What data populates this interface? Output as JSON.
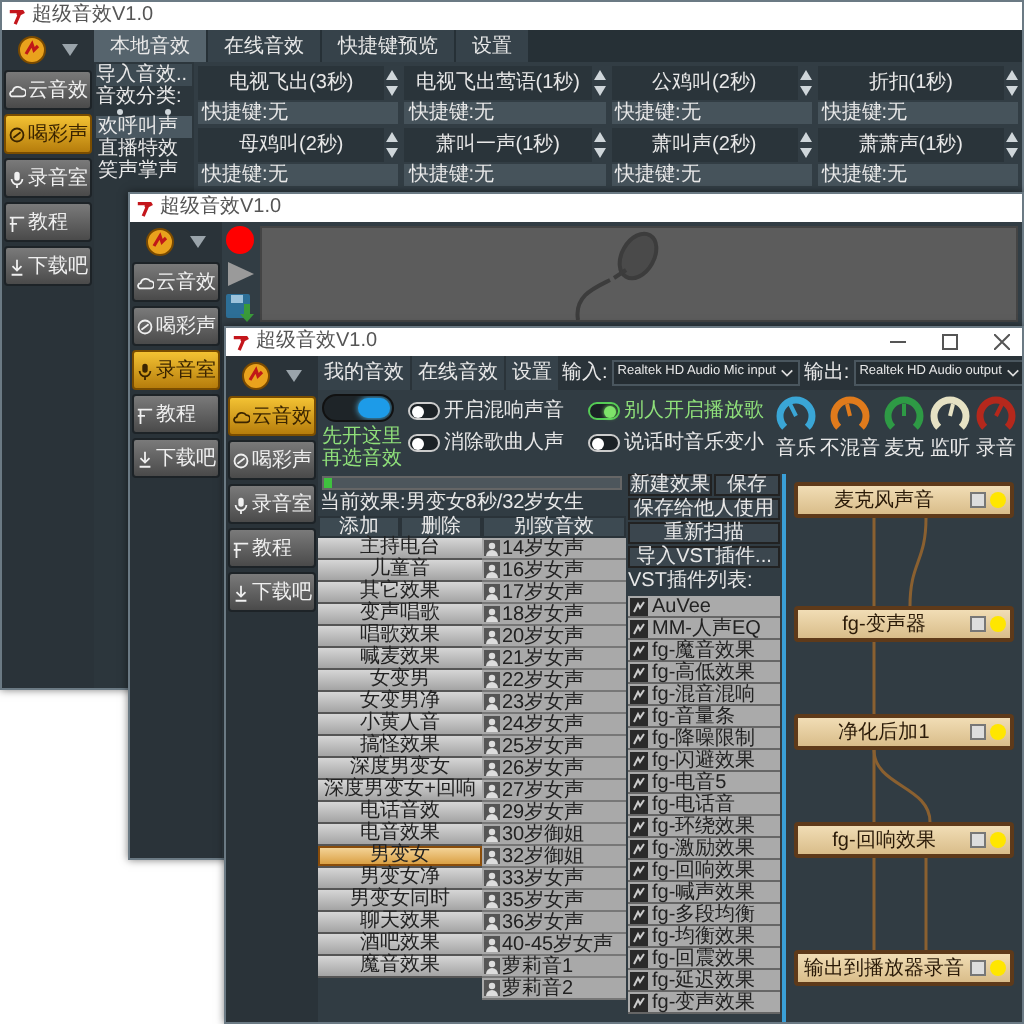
{
  "windows": [
    {
      "kind": "library",
      "title": "超级音效V1.0",
      "sidebar": [
        {
          "label": "云音效",
          "selected": false
        },
        {
          "label": "喝彩声",
          "selected": true
        },
        {
          "label": "录音室",
          "selected": false
        },
        {
          "label": "教程",
          "selected": false
        },
        {
          "label": "下载吧",
          "selected": false
        }
      ],
      "tabs": [
        {
          "label": "本地音效",
          "selected": true
        },
        {
          "label": "在线音效",
          "selected": false
        },
        {
          "label": "快捷键预览",
          "selected": false
        },
        {
          "label": "设置",
          "selected": false
        }
      ],
      "import_button": "导入音效..",
      "category_label": "音效分类:",
      "categories": [
        {
          "label": "欢呼叫声",
          "selected": true
        },
        {
          "label": "直播特效",
          "selected": false
        },
        {
          "label": "笑声掌声",
          "selected": false
        }
      ],
      "sounds": [
        {
          "name": "电视飞出(3秒)",
          "hotkey": "快捷键:无"
        },
        {
          "name": "电视飞出莺语(1秒)",
          "hotkey": "快捷键:无"
        },
        {
          "name": "公鸡叫(2秒)",
          "hotkey": "快捷键:无"
        },
        {
          "name": "折扣(1秒)",
          "hotkey": "快捷键:无"
        },
        {
          "name": "母鸡叫(2秒)",
          "hotkey": "快捷键:无"
        },
        {
          "name": "萧叫一声(1秒)",
          "hotkey": "快捷键:无"
        },
        {
          "name": "萧叫声(2秒)",
          "hotkey": "快捷键:无"
        },
        {
          "name": "萧萧声(1秒)",
          "hotkey": "快捷键:无"
        }
      ]
    },
    {
      "kind": "recorder",
      "title": "超级音效V1.0",
      "sidebar": [
        {
          "label": "云音效",
          "selected": false
        },
        {
          "label": "喝彩声",
          "selected": false
        },
        {
          "label": "录音室",
          "selected": true
        },
        {
          "label": "教程",
          "selected": false
        },
        {
          "label": "下载吧",
          "selected": false
        }
      ]
    },
    {
      "kind": "mixer",
      "title": "超级音效V1.0",
      "sidebar": [
        {
          "label": "云音效",
          "selected": true
        },
        {
          "label": "喝彩声",
          "selected": false
        },
        {
          "label": "录音室",
          "selected": false
        },
        {
          "label": "教程",
          "selected": false
        },
        {
          "label": "下载吧",
          "selected": false
        }
      ],
      "tabs": [
        "我的音效",
        "在线音效",
        "设置"
      ],
      "input": {
        "label": "输入:",
        "device": "Realtek HD Audio Mic input"
      },
      "output": {
        "label": "输出:",
        "device": "Realtek HD Audio output"
      },
      "power_switch": {
        "on": true,
        "label": "先开这里再选音效"
      },
      "toggles": [
        {
          "label": "开启混响声音",
          "on": false
        },
        {
          "label": "别人开启播放歌",
          "on": true
        },
        {
          "label": "消除歌曲人声",
          "on": false
        },
        {
          "label": "说话时音乐变小",
          "on": false
        }
      ],
      "knobs": [
        {
          "label": "音乐",
          "color": "#3aa6d6"
        },
        {
          "label": "不混音",
          "color": "#e07b1c"
        },
        {
          "label": "麦克",
          "color": "#2e9a45"
        },
        {
          "label": "监听",
          "color": "#e6e2c4"
        },
        {
          "label": "录音",
          "color": "#b5281c"
        }
      ],
      "meter": {
        "level": 0.03
      },
      "current_effect": "当前效果:男变女8秒/32岁女生",
      "list_headers": [
        "添加",
        "删除",
        "别致音效"
      ],
      "categories": [
        {
          "label": "主持电台",
          "selected": false
        },
        {
          "label": "儿童音",
          "selected": false
        },
        {
          "label": "其它效果",
          "selected": false
        },
        {
          "label": "变声唱歌",
          "selected": false
        },
        {
          "label": "唱歌效果",
          "selected": false
        },
        {
          "label": "喊麦效果",
          "selected": false
        },
        {
          "label": "女变男",
          "selected": false
        },
        {
          "label": "女变男净",
          "selected": false
        },
        {
          "label": "小黄人音",
          "selected": false
        },
        {
          "label": "搞怪效果",
          "selected": false
        },
        {
          "label": "深度男变女",
          "selected": false
        },
        {
          "label": "深度男变女+回响",
          "selected": false
        },
        {
          "label": "电话音效",
          "selected": false
        },
        {
          "label": "电音效果",
          "selected": false
        },
        {
          "label": "男变女",
          "selected": true
        },
        {
          "label": "男变女净",
          "selected": false
        },
        {
          "label": "男变女同时",
          "selected": false
        },
        {
          "label": "聊天效果",
          "selected": false
        },
        {
          "label": "酒吧效果",
          "selected": false
        },
        {
          "label": "魔音效果",
          "selected": false
        }
      ],
      "voices": [
        "14岁女声",
        "16岁女声",
        "17岁女声",
        "18岁女声",
        "20岁女声",
        "21岁女声",
        "22岁女声",
        "23岁女声",
        "24岁女声",
        "25岁女声",
        "26岁女声",
        "27岁女声",
        "29岁女声",
        "30岁御姐",
        "32岁御姐",
        "33岁女声",
        "35岁女声",
        "36岁女声",
        "40-45岁女声",
        "萝莉音1",
        "萝莉音2"
      ],
      "actions": [
        "新建效果",
        "保存",
        "保存给他人使用",
        "重新扫描",
        "导入VST插件..."
      ],
      "plugin_label": "VST插件列表:",
      "plugins": [
        "AuVee",
        "MM-人声EQ",
        "fg-魔音效果",
        "fg-高低效果",
        "fg-混音混响",
        "fg-音量条",
        "fg-降噪限制",
        "fg-闪避效果",
        "fg-电音5",
        "fg-电话音",
        "fg-环绕效果",
        "fg-激励效果",
        "fg-回响效果",
        "fg-喊声效果",
        "fg-多段均衡",
        "fg-均衡效果",
        "fg-回震效果",
        "fg-延迟效果",
        "fg-变声效果"
      ],
      "nodes": [
        "麦克风声音",
        "fg-变声器",
        "净化后加1",
        "fg-回响效果",
        "输出到播放器录音"
      ]
    }
  ]
}
